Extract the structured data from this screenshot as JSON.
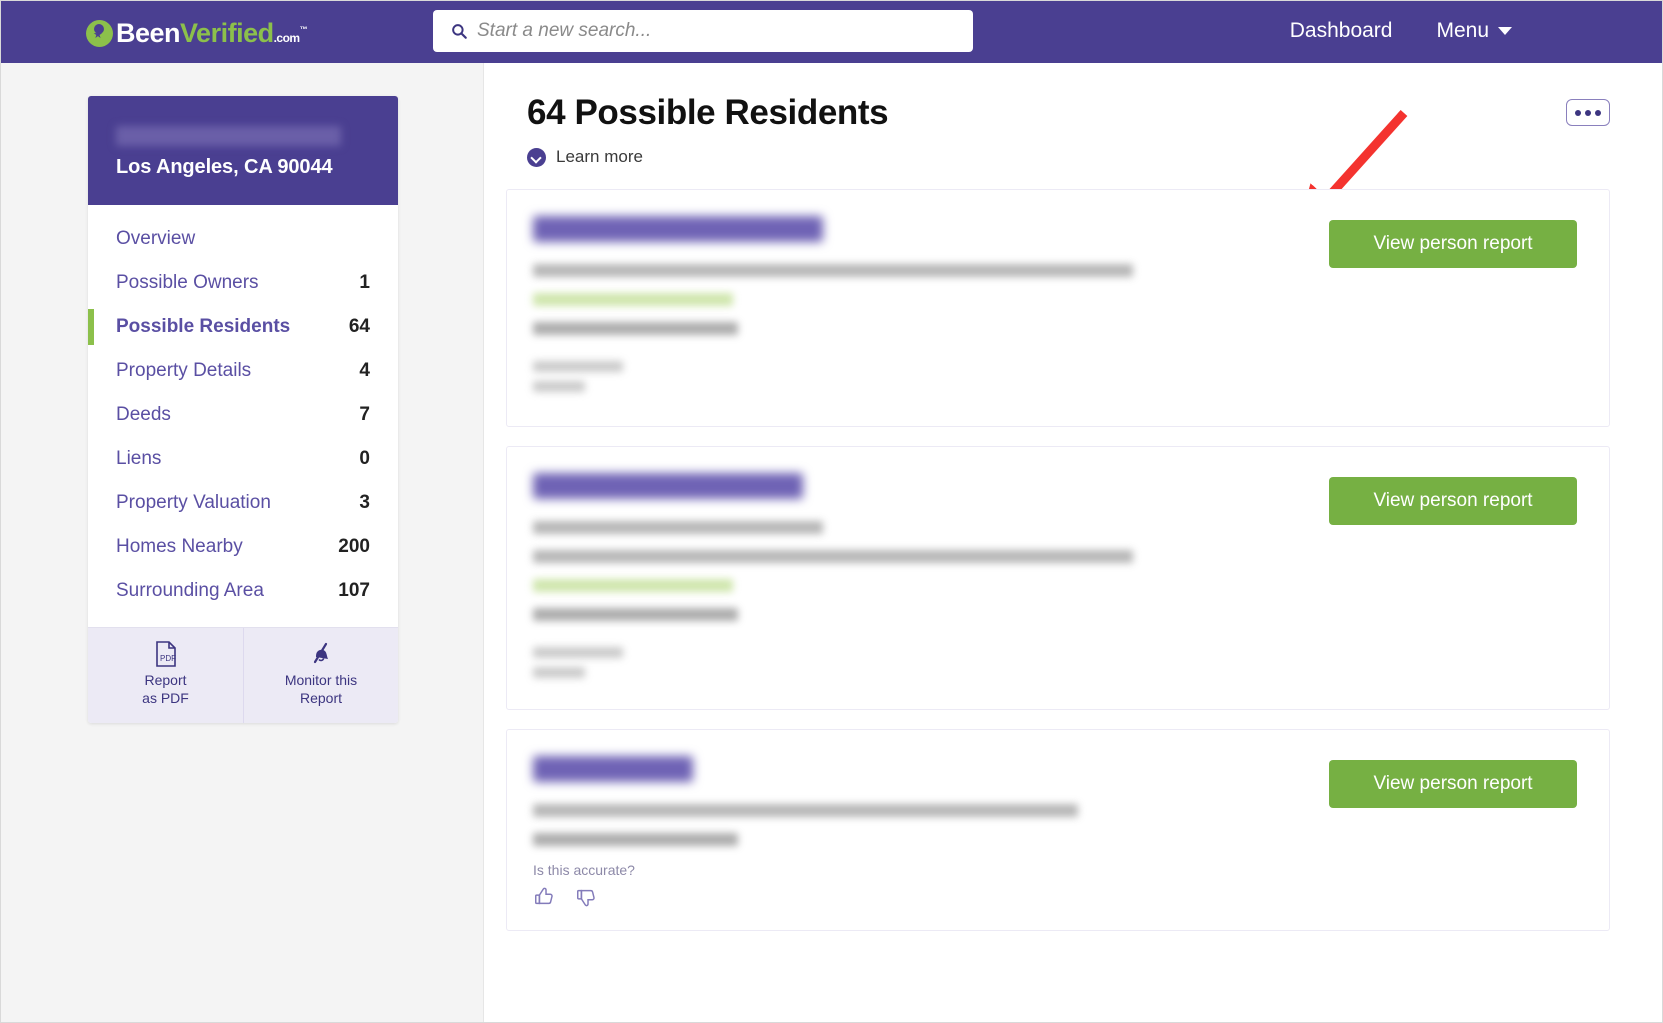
{
  "topnav": {
    "logo": {
      "part1": "Been",
      "part2": "Verified",
      "suffix": ".com",
      "tm": "™",
      "icon": "beenverified-logo-icon"
    },
    "search": {
      "placeholder": "Start a new search...",
      "value": "",
      "icon": "search-icon"
    },
    "links": [
      {
        "label": "Dashboard",
        "name": "nav-link-dashboard"
      },
      {
        "label": "Menu",
        "name": "nav-link-menu",
        "has_caret": true
      }
    ]
  },
  "sidebar": {
    "address_redacted": "",
    "city_state_zip": "Los Angeles, CA 90044",
    "items": [
      {
        "label": "Overview",
        "count": "",
        "active": false
      },
      {
        "label": "Possible Owners",
        "count": "1",
        "active": false
      },
      {
        "label": "Possible Residents",
        "count": "64",
        "active": true
      },
      {
        "label": "Property Details",
        "count": "4",
        "active": false
      },
      {
        "label": "Deeds",
        "count": "7",
        "active": false
      },
      {
        "label": "Liens",
        "count": "0",
        "active": false
      },
      {
        "label": "Property Valuation",
        "count": "3",
        "active": false
      },
      {
        "label": "Homes Nearby",
        "count": "200",
        "active": false
      },
      {
        "label": "Surrounding Area",
        "count": "107",
        "active": false
      }
    ],
    "actions": [
      {
        "line1": "Report",
        "line2": "as PDF",
        "icon": "pdf-file-icon"
      },
      {
        "line1": "Monitor this",
        "line2": "Report",
        "icon": "monitor-bell-icon"
      }
    ]
  },
  "main": {
    "title": "64 Possible Residents",
    "learn_more": "Learn more",
    "kebab_label": "•••",
    "cards": [
      {
        "button_label": "View person report",
        "show_accurate": false
      },
      {
        "button_label": "View person report",
        "show_accurate": false
      },
      {
        "button_label": "View person report",
        "show_accurate": true,
        "accurate_label": "Is this accurate?"
      }
    ]
  },
  "colors": {
    "brand_purple": "#4a3f91",
    "brand_green": "#8cc04b",
    "button_green": "#76b043",
    "link_purple": "#5a4fa3",
    "annotation_red": "#f4332f"
  }
}
